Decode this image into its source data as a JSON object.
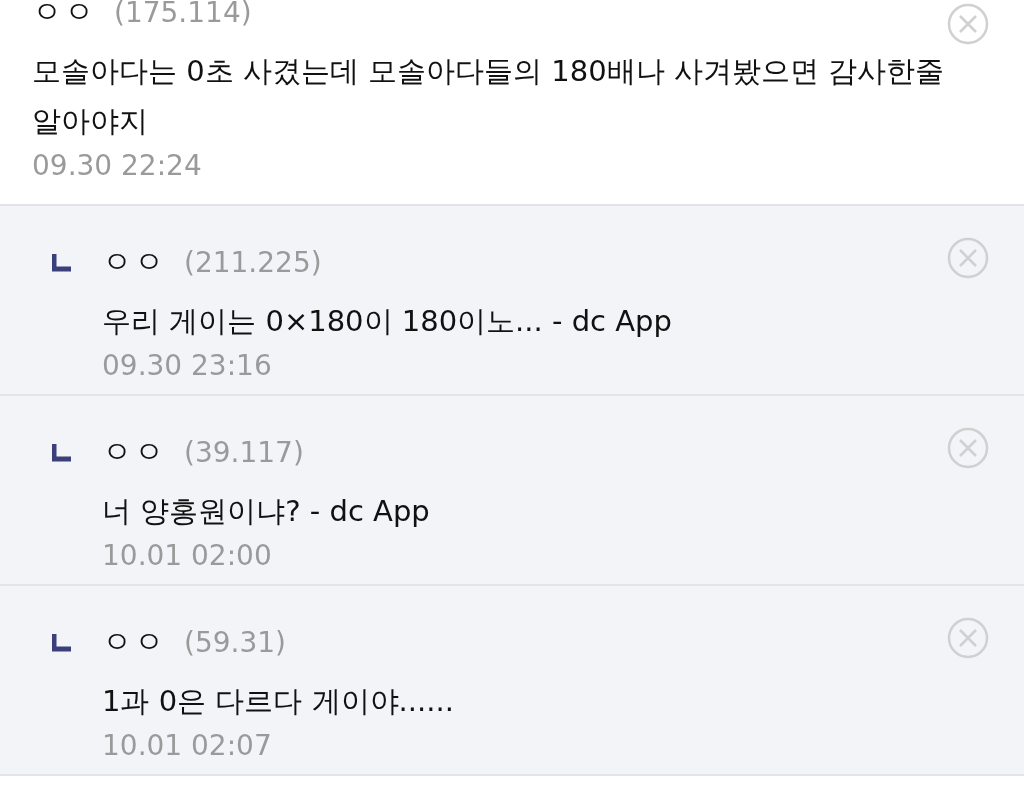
{
  "comments": [
    {
      "kind": "comment",
      "name": "ㅇㅇ",
      "ip": "(175.114)",
      "text": "모솔아다는 0초 사겼는데 모솔아다들의 180배나 사겨봤으면 감사한줄 알아야지",
      "date": "09.30 22:24"
    },
    {
      "kind": "reply",
      "name": "ㅇㅇ",
      "ip": "(211.225)",
      "text": "우리 게이는 0×180이 180이노... - dc App",
      "date": "09.30 23:16"
    },
    {
      "kind": "reply",
      "name": "ㅇㅇ",
      "ip": "(39.117)",
      "text": "너 양홍원이냐? - dc App",
      "date": "10.01 02:00"
    },
    {
      "kind": "reply",
      "name": "ㅇㅇ",
      "ip": "(59.31)",
      "text": "1과 0은 다르다 게이야......",
      "date": "10.01 02:07"
    }
  ]
}
